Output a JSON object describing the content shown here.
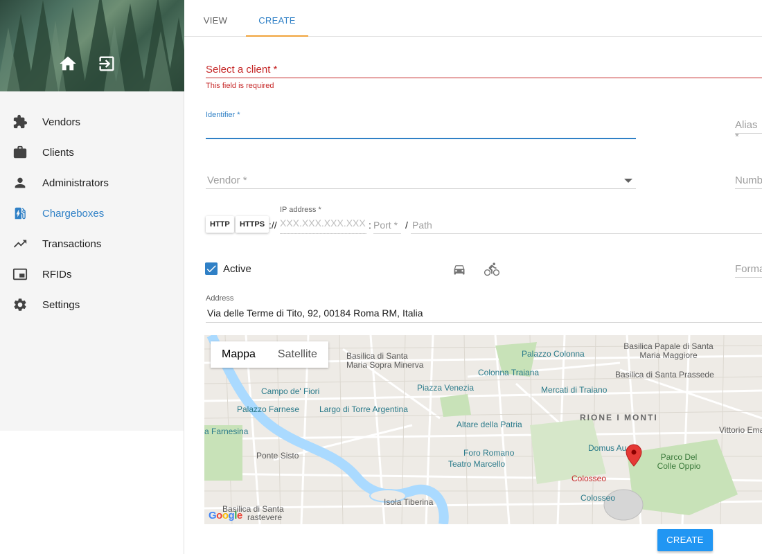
{
  "sidebar": {
    "items": [
      {
        "label": "Vendors",
        "icon": "puzzle-icon"
      },
      {
        "label": "Clients",
        "icon": "briefcase-icon"
      },
      {
        "label": "Administrators",
        "icon": "person-icon"
      },
      {
        "label": "Chargeboxes",
        "icon": "ev-station-icon",
        "active": true
      },
      {
        "label": "Transactions",
        "icon": "trending-up-icon"
      },
      {
        "label": "RFIDs",
        "icon": "card-icon"
      },
      {
        "label": "Settings",
        "icon": "gear-icon"
      }
    ]
  },
  "tabs": [
    {
      "label": "VIEW"
    },
    {
      "label": "CREATE",
      "active": true
    }
  ],
  "form": {
    "client_label": "Select a client *",
    "client_error": "This field is required",
    "identifier_label": "Identifier *",
    "alias_label": "Alias *",
    "vendor_label": "Vendor *",
    "number_label": "Numb",
    "http_label": "HTTP",
    "https_label": "HTTPS",
    "scheme_sep": "://",
    "ip_label": "IP address *",
    "ip_placeholder": "XXX.XXX.XXX.XXX",
    "port_sep": ":",
    "port_placeholder": "Port *",
    "path_sep": "/",
    "path_placeholder": "Path",
    "active_label": "Active",
    "active_checked": true,
    "format_label": "Forma",
    "address_label": "Address",
    "address_value": "Via delle Terme di Tito, 92, 00184 Roma RM, Italia",
    "create_label": "CREATE"
  },
  "map": {
    "toggle_map": "Mappa",
    "toggle_satellite": "Satellite",
    "google_logo": "Google",
    "labels": {
      "basilica_santa_maria_minerva": "Basilica di Santa Maria Sopra Minerva",
      "palazzo_colonna": "Palazzo Colonna",
      "basilica_papale": "Basilica Papale di Santa Maria Maggiore",
      "colonna_traiana": "Colonna Traiana",
      "basilica_prassede": "Basilica di Santa Prassede",
      "campo_de_fiori": "Campo de' Fiori",
      "piazza_venezia": "Piazza Venezia",
      "mercati_traiano": "Mercati di Traiano",
      "palazzo_farnese": "Palazzo Farnese",
      "largo_torre_argentina": "Largo di Torre Argentina",
      "altare_patria": "Altare della Patria",
      "rione_monti": "RIONE I MONTI",
      "vittorio_ema": "Vittorio Ema",
      "farnesina": "a Farnesina",
      "ponte_sisto": "Ponte Sisto",
      "foro_romano": "Foro Romano",
      "teatro_marcello": "Teatro Marcello",
      "domus_au": "Domus Au",
      "parco_colle_oppio": "Parco Del Colle Oppio",
      "colosseo_metro": "Colosseo",
      "colosseo": "Colosseo",
      "isola_tiberina": "Isola Tiberina",
      "basilica_santa": "Basilica di Santa",
      "trastevere": "rastevere"
    }
  }
}
